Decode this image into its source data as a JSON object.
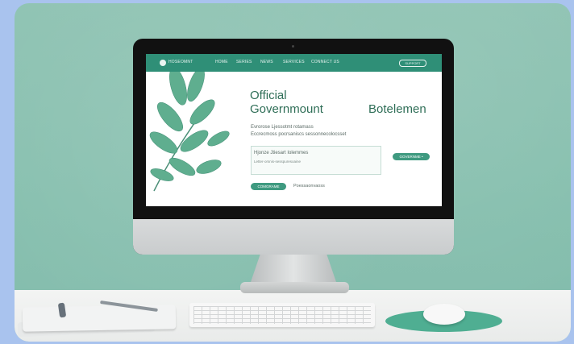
{
  "site": {
    "brand": "HOSEOMNT",
    "nav_items": [
      "HOME",
      "SERIES",
      "NEWS",
      "SERVICES",
      "CONNECT US"
    ],
    "nav_button": "SUPPORT",
    "title_line1": "Official",
    "title_line2": "Governmount",
    "title_right": "Botelemen",
    "subtext_line1": "Evrorose Ljessotmt rotamass",
    "subtext_line2": "Eccrecmoss pocrsaniscs sessonnecolocsset",
    "panel_heading": "Hjonze Jtiesart Iolemmes",
    "panel_subtext": "Letter-orsnis-sesspuresoaine",
    "panel_button": "GOVERNME •",
    "primary_button": "COMGRAME",
    "secondary_link": "Poessaonvaoss"
  },
  "colors": {
    "primary": "#2f8f77",
    "accent": "#3f9a80",
    "wall": "#8fc3b3"
  },
  "icons": {
    "logo": "leaf-logo-icon"
  }
}
